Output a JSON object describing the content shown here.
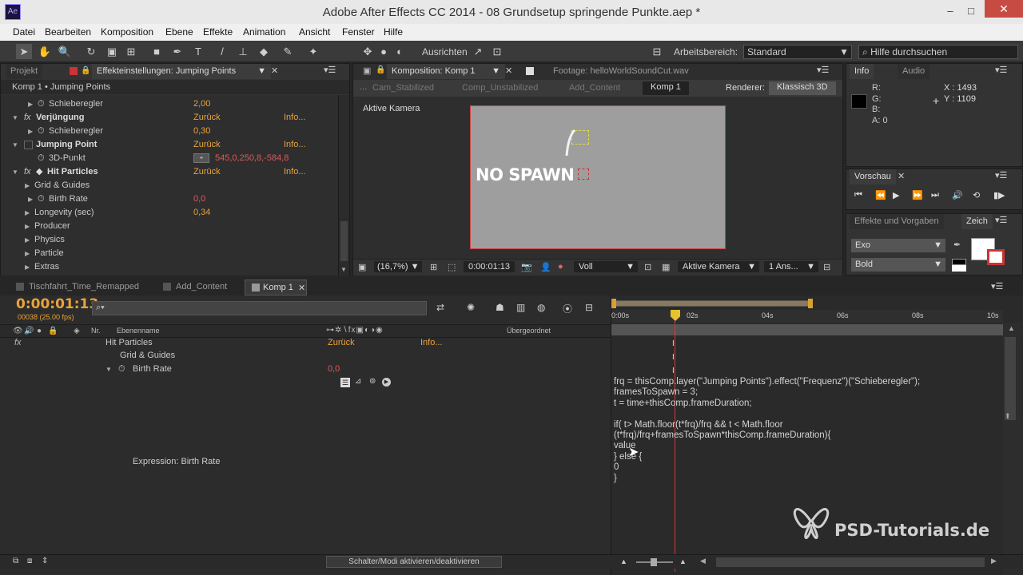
{
  "window": {
    "title": "Adobe After Effects CC 2014 - 08 Grundsetup springende Punkte.aep *",
    "app_icon": "Ae",
    "minimize": "–",
    "maximize": "□",
    "close": "✕"
  },
  "menu": [
    "Datei",
    "Bearbeiten",
    "Komposition",
    "Ebene",
    "Effekte",
    "Animation",
    "Ansicht",
    "Fenster",
    "Hilfe"
  ],
  "toolbar": {
    "align_label": "Ausrichten",
    "workspace_label": "Arbeitsbereich:",
    "workspace_value": "Standard",
    "help_search": "Hilfe durchsuchen"
  },
  "effects_panel": {
    "tab_project": "Projekt",
    "tab_effects": "Effekteinstellungen: Jumping Points",
    "breadcrumb": "Komp 1 • Jumping Points",
    "rows": [
      {
        "label": "Schieberegler",
        "value": "2,00",
        "link": ""
      },
      {
        "label": "Verjüngung",
        "value": "Zurück",
        "link": "Info..."
      },
      {
        "label": "Schieberegler",
        "value": "0,30",
        "link": ""
      },
      {
        "label": "Jumping Point",
        "value": "Zurück",
        "link": "Info..."
      },
      {
        "label": "3D-Punkt",
        "value": "545,0,250,8,-584,8",
        "link": ""
      },
      {
        "label": "Hit Particles",
        "value": "Zurück",
        "link": "Info..."
      },
      {
        "label": "Grid & Guides",
        "value": "",
        "link": ""
      },
      {
        "label": "Birth Rate",
        "value": "0,0",
        "link": ""
      },
      {
        "label": "Longevity (sec)",
        "value": "0,34",
        "link": ""
      },
      {
        "label": "Producer",
        "value": "",
        "link": ""
      },
      {
        "label": "Physics",
        "value": "",
        "link": ""
      },
      {
        "label": "Particle",
        "value": "",
        "link": ""
      },
      {
        "label": "Extras",
        "value": "",
        "link": ""
      }
    ]
  },
  "comp_panel": {
    "tab_comp": "Komposition: Komp 1",
    "tab_footage": "Footage: helloWorldSoundCut.wav",
    "crumbs": [
      "Cam_Stabilized",
      "Comp_Unstabilized",
      "Add_Content",
      "Komp 1"
    ],
    "renderer_label": "Renderer:",
    "renderer_value": "Klassisch 3D",
    "active_camera": "Aktive Kamera",
    "overlay_text": "NO SPAWN",
    "zoom": "(16,7%)",
    "timecode": "0:00:01:13",
    "quality": "Voll",
    "camera": "Aktive Kamera",
    "views": "1 Ans..."
  },
  "info_panel": {
    "tab_info": "Info",
    "tab_audio": "Audio",
    "r": "R:",
    "g": "G:",
    "b": "B:",
    "a": "A:",
    "a_val": "0",
    "x": "X : 1493",
    "y": "Y : 1109"
  },
  "preview_panel": {
    "tab": "Vorschau"
  },
  "char_panel": {
    "tab_effects": "Effekte und Vorgaben",
    "tab_char": "Zeich",
    "font": "Exo",
    "style": "Bold"
  },
  "timeline": {
    "tabs": [
      "Tischfahrt_Time_Remapped",
      "Add_Content",
      "Komp 1"
    ],
    "timecode": "0:00:01:13",
    "frames": "00038 (25.00 fps)",
    "search_placeholder": "",
    "col_nr": "Nr.",
    "col_name": "Ebenenname",
    "col_parent": "Übergeordnet",
    "rows": [
      {
        "label": "Hit Particles",
        "value": "Zurück",
        "link": "Info..."
      },
      {
        "label": "Grid & Guides",
        "value": "",
        "link": ""
      },
      {
        "label": "Birth Rate",
        "value": "0,0",
        "link": ""
      }
    ],
    "expression_label": "Expression: Birth Rate",
    "ruler": [
      "0:00s",
      "02s",
      "04s",
      "06s",
      "08s",
      "10s"
    ],
    "code": "frq = thisComp.layer(\"Jumping Points\").effect(\"Frequenz\")(\"Schieberegler\");\nframesToSpawn = 3;\nt = time+thisComp.frameDuration;\n\nif( t> Math.floor(t*frq)/frq && t < Math.floor\n(t*frq)/frq+framesToSpawn*thisComp.frameDuration){\nvalue\n} else {\n0\n}",
    "footer_toggle": "Schalter/Modi aktivieren/deaktivieren"
  },
  "watermark": "PSD-Tutorials.de"
}
